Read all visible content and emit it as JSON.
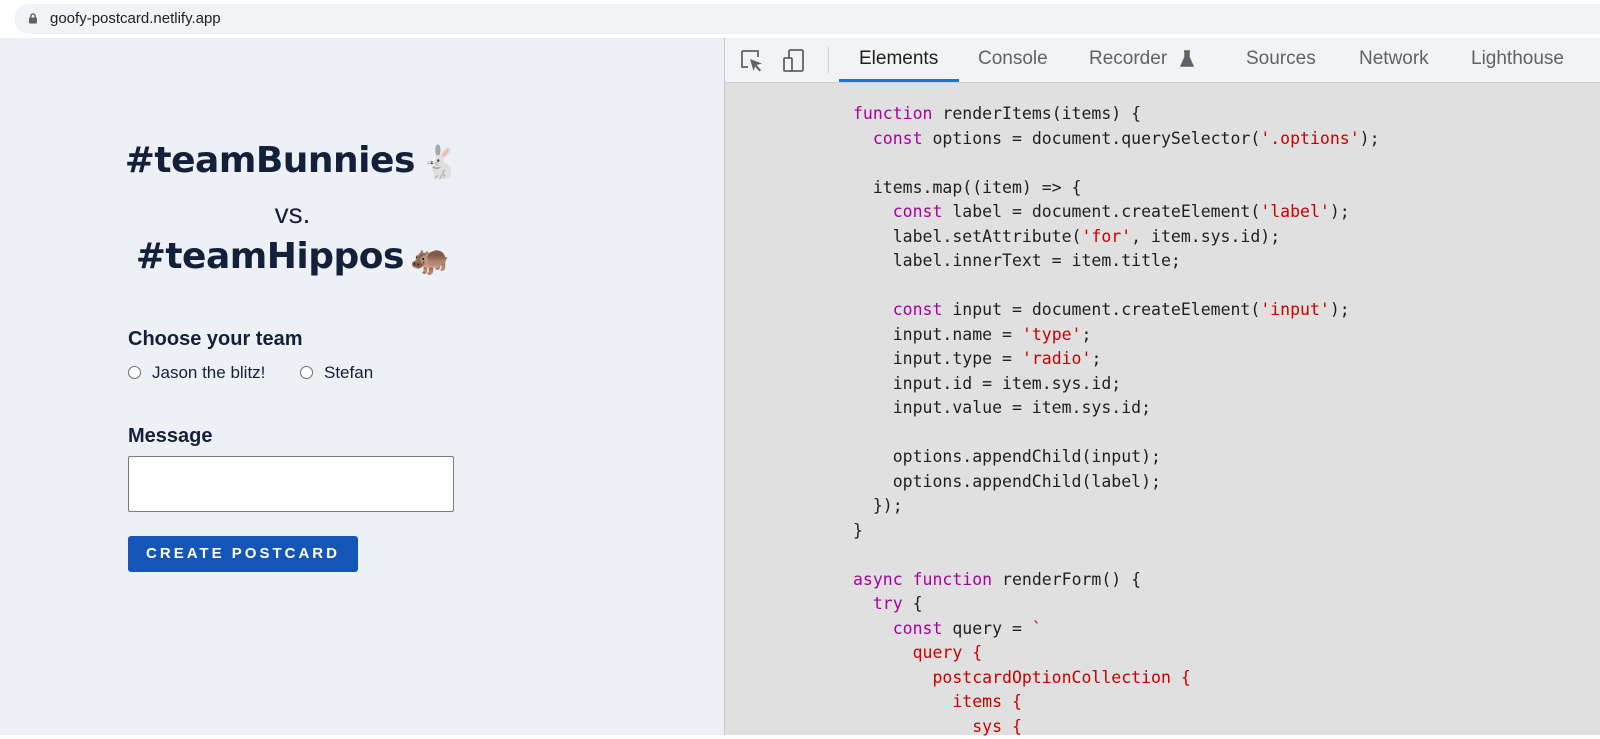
{
  "browser": {
    "url": "goofy-postcard.netlify.app"
  },
  "page": {
    "title_line1": "#teamBunnies",
    "title_emoji1": "🐇",
    "vs": "vs.",
    "title_line2": "#teamHippos",
    "title_emoji2": "🦛",
    "choose_label": "Choose your team",
    "options": [
      {
        "label": "Jason the blitz!",
        "selected": false
      },
      {
        "label": "Stefan",
        "selected": false
      }
    ],
    "message_label": "Message",
    "message_value": "",
    "button_label": "CREATE POSTCARD",
    "button_color": "#1456b8"
  },
  "devtools": {
    "tabs": [
      "Elements",
      "Console",
      "Recorder",
      "Sources",
      "Network",
      "Lighthouse"
    ],
    "active_tab": "Elements",
    "icons": [
      "inspect-element-icon",
      "device-toolbar-icon",
      "flask-icon"
    ],
    "code_lines": [
      [
        [
          "kw",
          "function"
        ],
        [
          "p",
          " renderItems(items) {"
        ]
      ],
      [
        [
          "p",
          "  "
        ],
        [
          "kw",
          "const"
        ],
        [
          "p",
          " options = document.querySelector("
        ],
        [
          "str",
          "'.options'"
        ],
        [
          "p",
          ");"
        ]
      ],
      [
        [
          "p",
          ""
        ]
      ],
      [
        [
          "p",
          "  items.map((item) => {"
        ]
      ],
      [
        [
          "p",
          "    "
        ],
        [
          "kw",
          "const"
        ],
        [
          "p",
          " label = document.createElement("
        ],
        [
          "str",
          "'label'"
        ],
        [
          "p",
          ");"
        ]
      ],
      [
        [
          "p",
          "    label.setAttribute("
        ],
        [
          "str",
          "'for'"
        ],
        [
          "p",
          ", item.sys.id);"
        ]
      ],
      [
        [
          "p",
          "    label.innerText = item.title;"
        ]
      ],
      [
        [
          "p",
          ""
        ]
      ],
      [
        [
          "p",
          "    "
        ],
        [
          "kw",
          "const"
        ],
        [
          "p",
          " input = document.createElement("
        ],
        [
          "str",
          "'input'"
        ],
        [
          "p",
          ");"
        ]
      ],
      [
        [
          "p",
          "    input.name = "
        ],
        [
          "str",
          "'type'"
        ],
        [
          "p",
          ";"
        ]
      ],
      [
        [
          "p",
          "    input.type = "
        ],
        [
          "str",
          "'radio'"
        ],
        [
          "p",
          ";"
        ]
      ],
      [
        [
          "p",
          "    input.id = item.sys.id;"
        ]
      ],
      [
        [
          "p",
          "    input.value = item.sys.id;"
        ]
      ],
      [
        [
          "p",
          ""
        ]
      ],
      [
        [
          "p",
          "    options.appendChild(input);"
        ]
      ],
      [
        [
          "p",
          "    options.appendChild(label);"
        ]
      ],
      [
        [
          "p",
          "  });"
        ]
      ],
      [
        [
          "p",
          "}"
        ]
      ],
      [
        [
          "p",
          ""
        ]
      ],
      [
        [
          "kw",
          "async"
        ],
        [
          "p",
          " "
        ],
        [
          "kw",
          "function"
        ],
        [
          "p",
          " renderForm() {"
        ]
      ],
      [
        [
          "p",
          "  "
        ],
        [
          "kw",
          "try"
        ],
        [
          "p",
          " {"
        ]
      ],
      [
        [
          "p",
          "    "
        ],
        [
          "kw",
          "const"
        ],
        [
          "p",
          " query = "
        ],
        [
          "str",
          "`"
        ]
      ],
      [
        [
          "str",
          "      query {"
        ]
      ],
      [
        [
          "str",
          "        postcardOptionCollection {"
        ]
      ],
      [
        [
          "str",
          "          items {"
        ]
      ],
      [
        [
          "str",
          "            sys {"
        ]
      ]
    ],
    "colors": {
      "keyword": "#a8009f",
      "string": "#c80000",
      "tab_underline": "#1a73e8"
    }
  }
}
